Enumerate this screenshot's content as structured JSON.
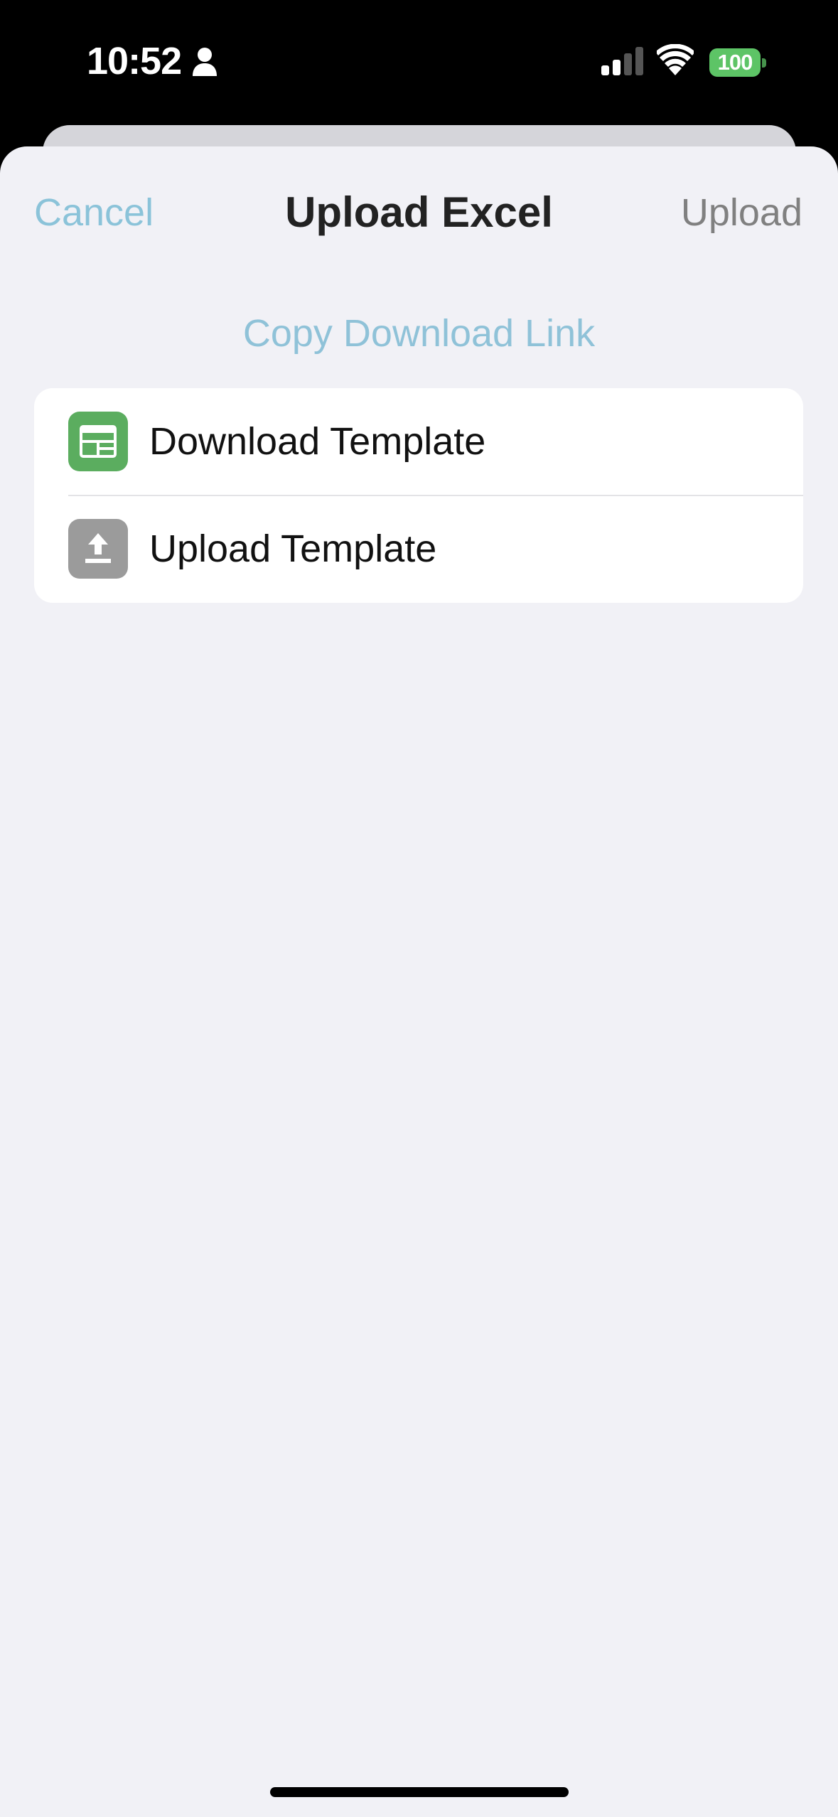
{
  "status_bar": {
    "time": "10:52",
    "battery_level": "100",
    "battery_color": "#5dc466"
  },
  "nav": {
    "cancel_label": "Cancel",
    "title": "Upload Excel",
    "upload_label": "Upload"
  },
  "copy_link_label": "Copy Download Link",
  "list": {
    "items": [
      {
        "label": "Download Template",
        "icon": "spreadsheet-icon",
        "icon_color": "#5bad5f"
      },
      {
        "label": "Upload Template",
        "icon": "upload-icon",
        "icon_color": "#9b9b9b"
      }
    ]
  },
  "colors": {
    "accent": "#8bc3d9",
    "sheet_background": "#f1f1f6"
  }
}
